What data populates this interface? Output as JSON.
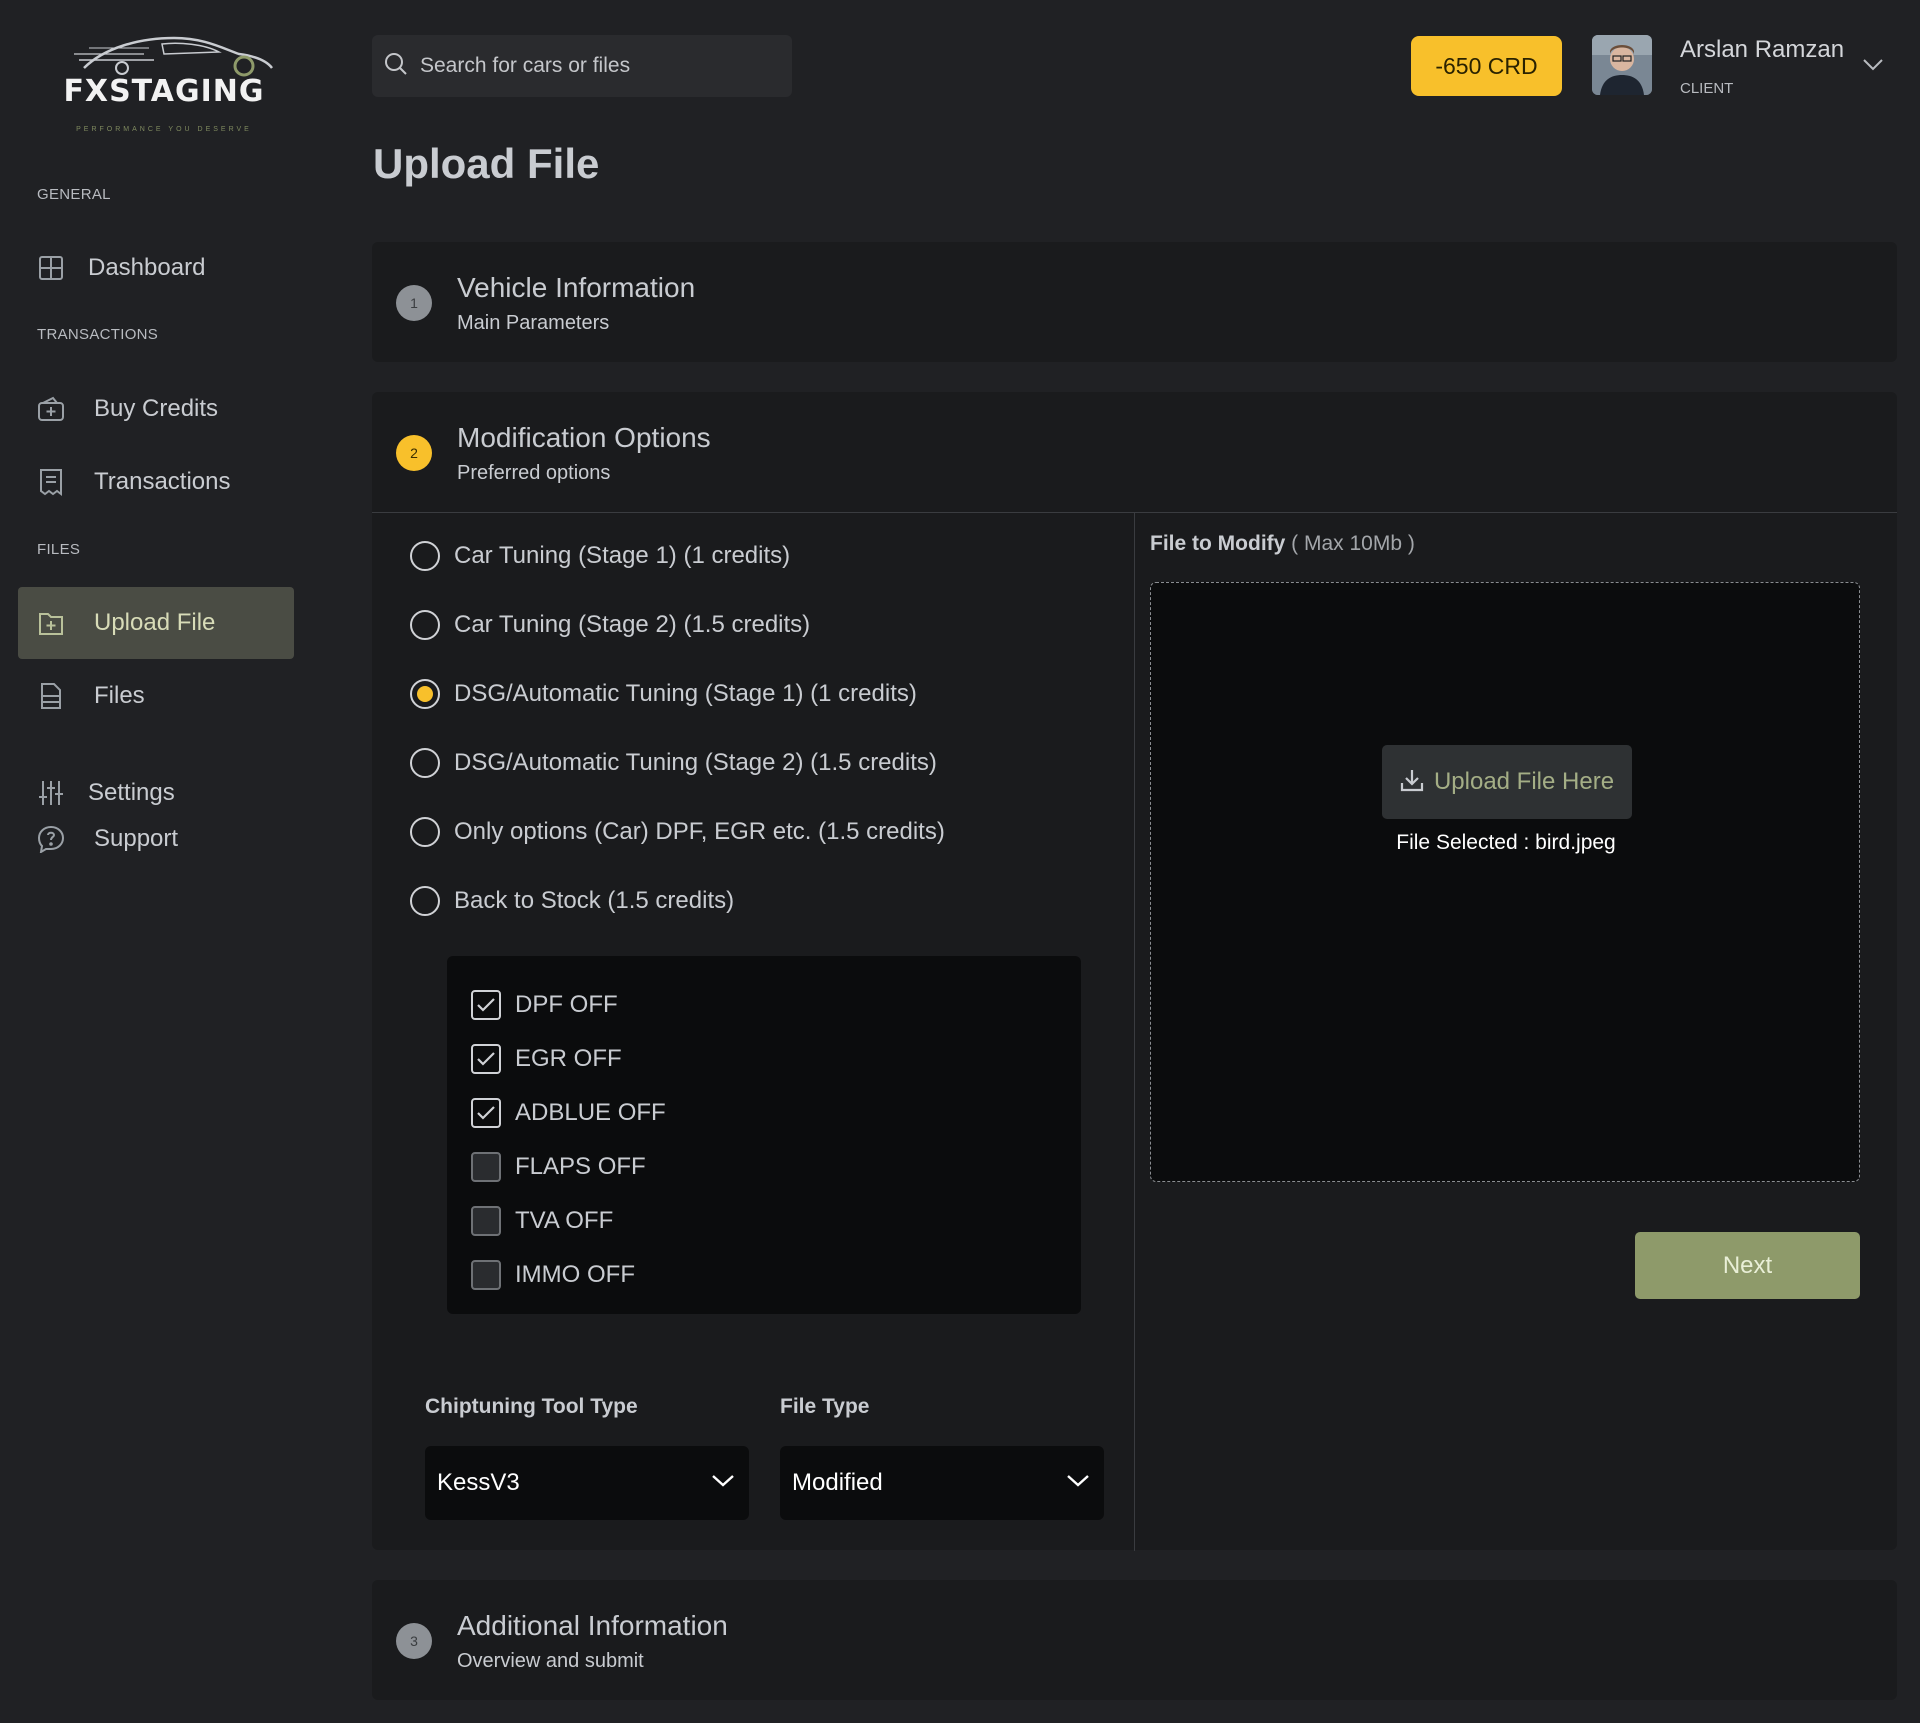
{
  "brand": {
    "logo_text_fx": "FX",
    "logo_text_rest": "STAGING",
    "tagline": "PERFORMANCE YOU DESERVE",
    "accent": "#f8c02b",
    "green": "#8e9a6a"
  },
  "sidebar": {
    "sections": {
      "general": "GENERAL",
      "transactions": "TRANSACTIONS",
      "files": "FILES"
    },
    "items": [
      {
        "label": "Dashboard",
        "icon": "grid-icon"
      },
      {
        "label": "Buy Credits",
        "icon": "wallet-plus-icon"
      },
      {
        "label": "Transactions",
        "icon": "receipt-icon"
      },
      {
        "label": "Upload File",
        "icon": "file-plus-icon",
        "active": true
      },
      {
        "label": "Files",
        "icon": "files-icon"
      },
      {
        "label": "Settings",
        "icon": "sliders-icon"
      },
      {
        "label": "Support",
        "icon": "help-bubble-icon"
      }
    ]
  },
  "header": {
    "search_placeholder": "Search for cars or files",
    "credits": "-650 CRD",
    "user_name": "Arslan Ramzan",
    "user_role": "CLIENT"
  },
  "page": {
    "title": "Upload File"
  },
  "steps": [
    {
      "number": "1",
      "title": "Vehicle Information",
      "subtitle": "Main Parameters"
    },
    {
      "number": "2",
      "title": "Modification Options",
      "subtitle": "Preferred options"
    },
    {
      "number": "3",
      "title": "Additional Information",
      "subtitle": "Overview and submit"
    }
  ],
  "modification": {
    "radio_options": [
      {
        "label": "Car Tuning (Stage 1) (1 credits)",
        "checked": false
      },
      {
        "label": "Car Tuning (Stage 2) (1.5 credits)",
        "checked": false
      },
      {
        "label": "DSG/Automatic Tuning (Stage 1) (1 credits)",
        "checked": true
      },
      {
        "label": "DSG/Automatic Tuning (Stage 2) (1.5 credits)",
        "checked": false
      },
      {
        "label": "Only options (Car) DPF, EGR etc. (1.5 credits)",
        "checked": false
      },
      {
        "label": "Back to Stock (1.5 credits)",
        "checked": false
      }
    ],
    "checkboxes": [
      {
        "label": "DPF OFF",
        "checked": true
      },
      {
        "label": "EGR OFF",
        "checked": true
      },
      {
        "label": "ADBLUE OFF",
        "checked": true
      },
      {
        "label": "FLAPS OFF",
        "checked": false
      },
      {
        "label": "TVA OFF",
        "checked": false
      },
      {
        "label": "IMMO OFF",
        "checked": false
      }
    ],
    "tool_type_label": "Chiptuning Tool Type",
    "tool_type_value": "KessV3",
    "file_type_label": "File Type",
    "file_type_value": "Modified",
    "file_label": "File to Modify",
    "file_hint": "( Max 10Mb )",
    "upload_button": "Upload File Here",
    "file_selected_prefix": "File Selected : ",
    "file_selected_name": "bird.jpeg",
    "next_button": "Next"
  }
}
